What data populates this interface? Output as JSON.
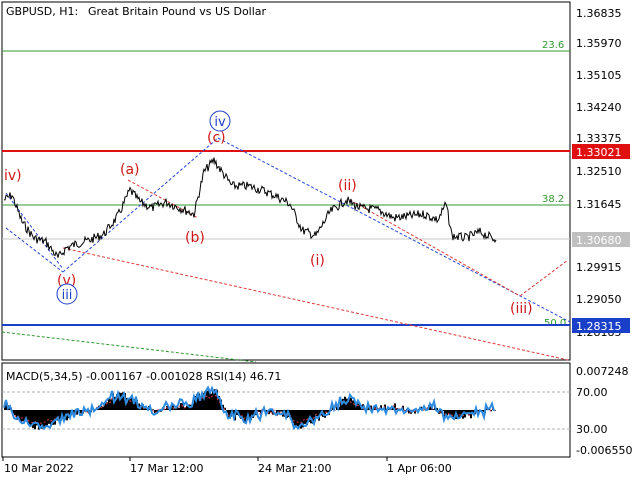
{
  "header": {
    "symbol_timeframe": "GBPUSD, H1:",
    "instrument_name": "Great Britain Pound vs US Dollar"
  },
  "price_axis": {
    "ticks": [
      "1.36835",
      "1.35970",
      "1.35105",
      "1.34240",
      "1.33375",
      "1.32510",
      "1.31645",
      "1.30780",
      "1.29915",
      "1.29050",
      "1.28185"
    ],
    "badges": [
      {
        "name": "resistance",
        "text": "1.33021",
        "color": "#e01010"
      },
      {
        "name": "current",
        "text": "1.30680",
        "color": "#c0c0c0"
      },
      {
        "name": "support",
        "text": "1.28315",
        "color": "#1a3fc8"
      }
    ]
  },
  "fib_labels": {
    "f236": "23.6",
    "f382": "38.2",
    "f500": "50.0"
  },
  "wave_labels": {
    "iv_left": "iv)",
    "a": "(a)",
    "b": "(b)",
    "c": "(c)",
    "iv_circle": "iv",
    "v": "(v)",
    "iii_circle": "iii",
    "i": "(i)",
    "ii": "(ii)",
    "iii_small": "(iii)"
  },
  "indicator": {
    "label": "MACD(5,34,5) -0.001167 -0.001028 RSI(14) 46.71",
    "axis": {
      "top": "0.007248",
      "rsi70": "70.00",
      "rsi30": "30.00",
      "bottom": "-0.006550"
    }
  },
  "time_axis": {
    "ticks": [
      "10 Mar 2022",
      "17 Mar 12:00",
      "24 Mar 21:00",
      "1 Apr 06:00"
    ]
  },
  "colors": {
    "resistance": "#e01010",
    "support": "#1a3fc8",
    "fib": "#2f9a2f",
    "wave_label": "#d01818",
    "wave_circle": "#1a3fc8",
    "channel_blue": "#2846d8",
    "channel_red": "#e03a3a",
    "price": "#000000",
    "macd_hist": "#000000",
    "rsi": "#2d8be0"
  }
}
